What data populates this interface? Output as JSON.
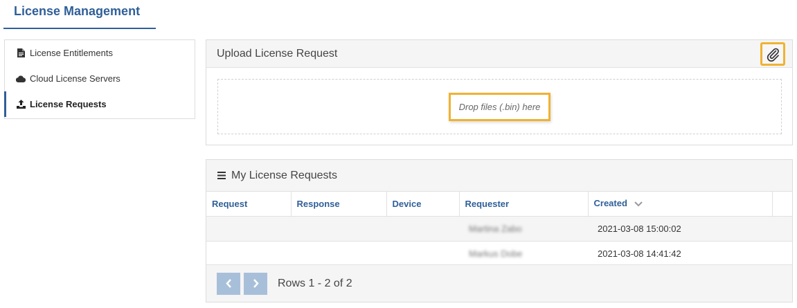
{
  "header": {
    "title": "License Management"
  },
  "sidebar": {
    "items": [
      {
        "label": "License Entitlements",
        "icon": "document-icon",
        "active": false
      },
      {
        "label": "Cloud License Servers",
        "icon": "cloud-icon",
        "active": false
      },
      {
        "label": "License Requests",
        "icon": "upload-icon",
        "active": true
      }
    ]
  },
  "upload": {
    "title": "Upload License Request",
    "attach_icon": "paperclip-icon",
    "drop_label": "Drop files (.bin) here"
  },
  "requests": {
    "title": "My License Requests",
    "columns": [
      "Request",
      "Response",
      "Device",
      "Requester",
      "Created"
    ],
    "rows": [
      {
        "request": "",
        "response": "",
        "device": "",
        "requester": "Martina Zabo",
        "created": "2021-03-08 15:00:02"
      },
      {
        "request": "",
        "response": "",
        "device": "",
        "requester": "Markus Dobe",
        "created": "2021-03-08 14:41:42"
      }
    ],
    "pagination": {
      "info": "Rows 1 - 2 of 2"
    }
  },
  "colors": {
    "accent": "#2f5f98",
    "highlight": "#f0b232",
    "pager": "#a8bfd9"
  }
}
